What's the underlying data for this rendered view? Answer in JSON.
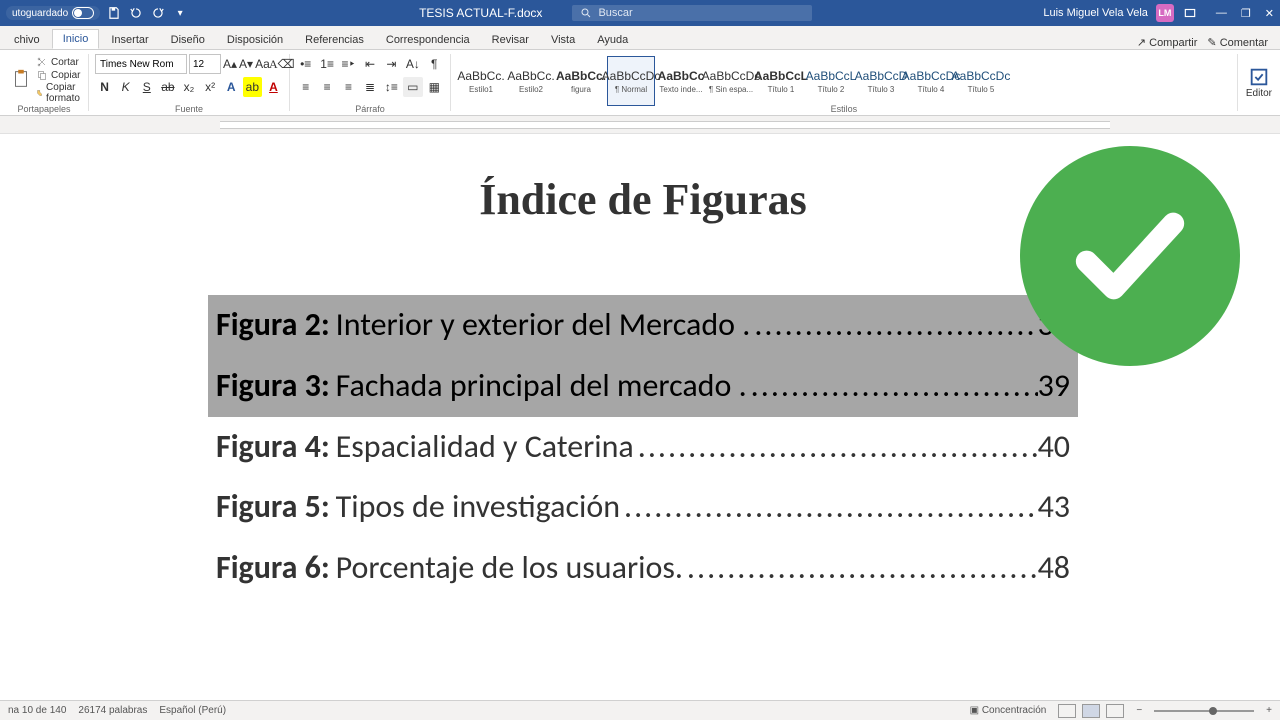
{
  "title_bar": {
    "autoguardado_label": "utoguardado",
    "document_name": "TESIS ACTUAL-F.docx",
    "search_placeholder": "Buscar",
    "user_name": "Luis Miguel Vela Vela",
    "user_initials": "LM"
  },
  "tabs": {
    "archivo": "chivo",
    "inicio": "Inicio",
    "insertar": "Insertar",
    "diseno": "Diseño",
    "disposicion": "Disposición",
    "referencias": "Referencias",
    "correspondencia": "Correspondencia",
    "revisar": "Revisar",
    "vista": "Vista",
    "ayuda": "Ayuda",
    "compartir": "Compartir",
    "comentar": "Comentar"
  },
  "ribbon": {
    "portapapeles": "Portapapeles",
    "cortar": "Cortar",
    "copiar": "Copiar",
    "copiar_formato": "Copiar formato",
    "fuente": "Fuente",
    "font_name": "Times New Rom",
    "font_size": "12",
    "parrafo": "Párrafo",
    "estilos": "Estilos",
    "editor": "Editor",
    "styles": [
      {
        "preview": "AaBbCc.",
        "label": "Estilo1",
        "preview_class": ""
      },
      {
        "preview": "AaBbCc.",
        "label": "Estilo2",
        "preview_class": ""
      },
      {
        "preview": "AaBbCc.",
        "label": "figura",
        "preview_class": "bold"
      },
      {
        "preview": "AaBbCcDc",
        "label": "¶ Normal",
        "preview_class": ""
      },
      {
        "preview": "AaBbCc",
        "label": "Texto inde...",
        "preview_class": "bold"
      },
      {
        "preview": "AaBbCcDc",
        "label": "¶ Sin espa...",
        "preview_class": ""
      },
      {
        "preview": "AaBbCcL",
        "label": "Título 1",
        "preview_class": "bold"
      },
      {
        "preview": "AaBbCcL",
        "label": "Título 2",
        "preview_class": "blue"
      },
      {
        "preview": "AaBbCcD",
        "label": "Título 3",
        "preview_class": "blue"
      },
      {
        "preview": "AaBbCcDc",
        "label": "Título 4",
        "preview_class": "blue"
      },
      {
        "preview": "AaBbCcDc",
        "label": "Título 5",
        "preview_class": "blue"
      }
    ]
  },
  "document": {
    "heading": "Índice de Figuras",
    "figures": [
      {
        "label": "Figura 2:",
        "text": "Interior y exterior del Mercado .",
        "page": "38",
        "selected": true
      },
      {
        "label": "Figura 3:",
        "text": "Fachada principal del mercado .",
        "page": "39",
        "selected": true
      },
      {
        "label": "Figura 4:",
        "text": "Espacialidad y  Caterina",
        "page": "40",
        "selected": false
      },
      {
        "label": "Figura 5:",
        "text": "Tipos de investigación",
        "page": "43",
        "selected": false
      },
      {
        "label": "Figura 6:",
        "text": "Porcentaje de los usuarios.",
        "page": "48",
        "selected": false
      }
    ]
  },
  "status": {
    "page": "na 10 de 140",
    "words": "26174 palabras",
    "language": "Español (Perú)",
    "focus": "Concentración"
  }
}
